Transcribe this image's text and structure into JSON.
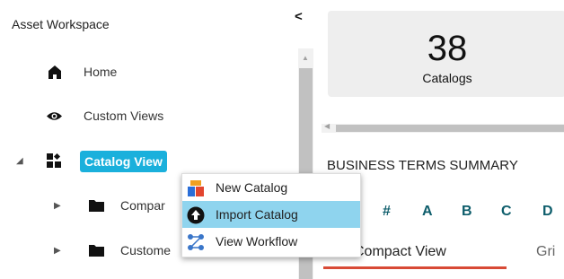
{
  "workspace": {
    "title": "Asset Workspace",
    "collapse_glyph": "<",
    "tree": {
      "home": "Home",
      "custom_views": "Custom Views",
      "catalog_view": "Catalog View",
      "children": [
        "Compar",
        "Custome"
      ]
    }
  },
  "context_menu": {
    "items": [
      {
        "label": "New Catalog",
        "icon": "new-catalog-icon"
      },
      {
        "label": "Import Catalog",
        "icon": "upload-icon"
      },
      {
        "label": "View Workflow",
        "icon": "workflow-icon"
      }
    ],
    "highlighted_index": 1
  },
  "kpi": {
    "value": "38",
    "label": "Catalogs"
  },
  "summary": {
    "title": "BUSINESS TERMS SUMMARY",
    "alphabet": [
      "#",
      "A",
      "B",
      "C",
      "D"
    ],
    "tabs": [
      "Compact View",
      "Gri"
    ]
  },
  "colors": {
    "accent": "#1ab0dc",
    "menu_highlight": "#8fd4ee",
    "alpha_text": "#0d5d6b",
    "tab_underline": "#d84a36",
    "card_bg": "#eeeeee"
  }
}
